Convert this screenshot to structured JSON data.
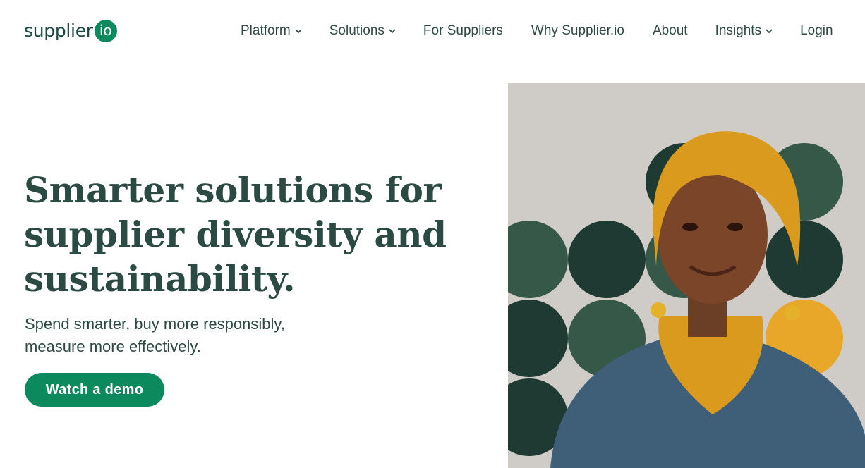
{
  "header": {
    "logo_text": "supplier",
    "logo_badge": "io",
    "nav": [
      {
        "label": "Platform",
        "has_dropdown": true,
        "icon": "chevron-down-icon"
      },
      {
        "label": "Solutions",
        "has_dropdown": true,
        "icon": "chevron-down-icon"
      },
      {
        "label": "For Suppliers",
        "has_dropdown": false
      },
      {
        "label": "Why Supplier.io",
        "has_dropdown": false
      },
      {
        "label": "About",
        "has_dropdown": false
      },
      {
        "label": "Insights",
        "has_dropdown": true,
        "icon": "chevron-down-icon"
      },
      {
        "label": "Login",
        "has_dropdown": false
      }
    ]
  },
  "hero": {
    "headline": "Smarter solutions for supplier diversity and sustainability.",
    "subhead_line1": "Spend smarter, buy more responsibly,",
    "subhead_line2": "measure more effectively.",
    "cta_label": "Watch a demo"
  },
  "colors": {
    "brand_green": "#0c8a5d",
    "text_dark_green": "#2c4a44",
    "circle_dark": "#1e3a32",
    "circle_mid": "#355848",
    "circle_yellow": "#e9a72a",
    "image_bg": "#cfcbc7"
  }
}
